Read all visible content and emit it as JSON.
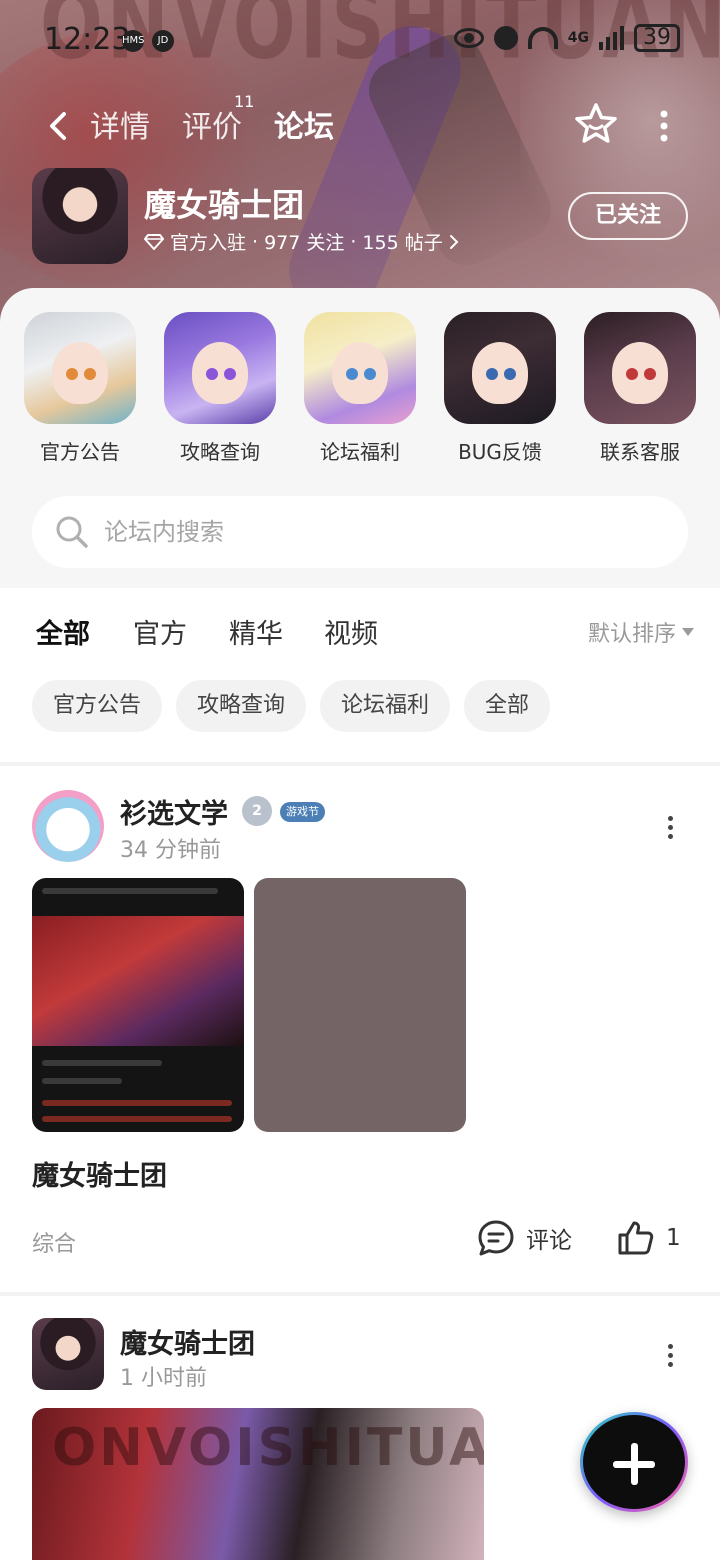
{
  "status_bar": {
    "time": "12:23",
    "icon1": "HMS",
    "icon2": "JD",
    "network": "4G",
    "battery": "39"
  },
  "nav": {
    "tabs": [
      {
        "label": "详情"
      },
      {
        "label": "评价",
        "superscript": "11"
      },
      {
        "label": "论坛"
      }
    ],
    "active_tab": "论坛",
    "banner_watermark": "ONVOISHITUAN"
  },
  "game": {
    "name": "魔女骑士团",
    "verified_label": "官方入驻",
    "followers": "977 关注",
    "posts": "155 帖子",
    "separator": "·",
    "follow_button": "已关注"
  },
  "shortcuts": [
    {
      "label": "官方公告"
    },
    {
      "label": "攻略查询"
    },
    {
      "label": "论坛福利"
    },
    {
      "label": "BUG反馈"
    },
    {
      "label": "联系客服"
    }
  ],
  "search": {
    "placeholder": "论坛内搜索"
  },
  "filter_tabs": [
    {
      "label": "全部"
    },
    {
      "label": "官方"
    },
    {
      "label": "精华"
    },
    {
      "label": "视频"
    }
  ],
  "sort_label": "默认排序",
  "chips": [
    {
      "label": "官方公告"
    },
    {
      "label": "攻略查询"
    },
    {
      "label": "论坛福利"
    },
    {
      "label": "全部"
    }
  ],
  "posts": [
    {
      "author": "衫选文学",
      "level_badge": "2",
      "tag_badge": "游戏节",
      "time": "34 分钟前",
      "title": "魔女骑士团",
      "category": "综合",
      "comment_label": "评论",
      "like_count": "1"
    },
    {
      "author": "魔女骑士团",
      "time": "1 小时前",
      "image_watermark": "ONVOISHITUAN"
    }
  ],
  "colors": {
    "accent": "#2ad3b8",
    "banner": "#a07278"
  }
}
